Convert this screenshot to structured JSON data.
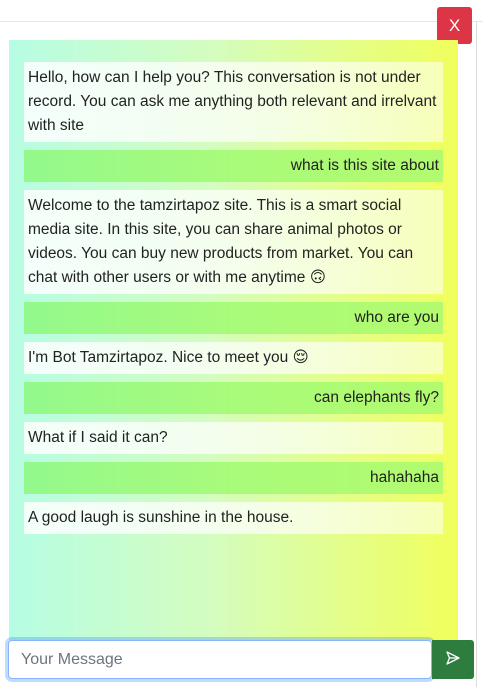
{
  "close_button": {
    "label": "X"
  },
  "messages": [
    {
      "role": "bot",
      "text": "Hello, how can I help you? This conversation is not under record. You can ask me anything both relevant and irrelvant with site"
    },
    {
      "role": "user",
      "text": "what is this site about"
    },
    {
      "role": "bot",
      "text": "Welcome to the tamzirtapoz site. This is a smart social media site. In this site, you can share animal photos or videos. You can buy new products from market. You can chat with other users or with me anytime 🙃"
    },
    {
      "role": "user",
      "text": "who are you"
    },
    {
      "role": "bot",
      "text": "I'm Bot Tamzirtapoz. Nice to meet you 😌"
    },
    {
      "role": "user",
      "text": "can elephants fly?"
    },
    {
      "role": "bot",
      "text": "What if I said it can?"
    },
    {
      "role": "user",
      "text": "hahahaha"
    },
    {
      "role": "bot",
      "text": "A good laugh is sunshine in the house."
    }
  ],
  "input": {
    "placeholder": "Your Message",
    "value": ""
  },
  "send_button": {
    "icon": "send-icon"
  },
  "colors": {
    "close_button": "#dc3545",
    "send_button": "#2e7d3e",
    "gradient_start": "#b6fde4",
    "gradient_end": "#f1ff5c",
    "user_bubble": "#a9fb7a"
  }
}
